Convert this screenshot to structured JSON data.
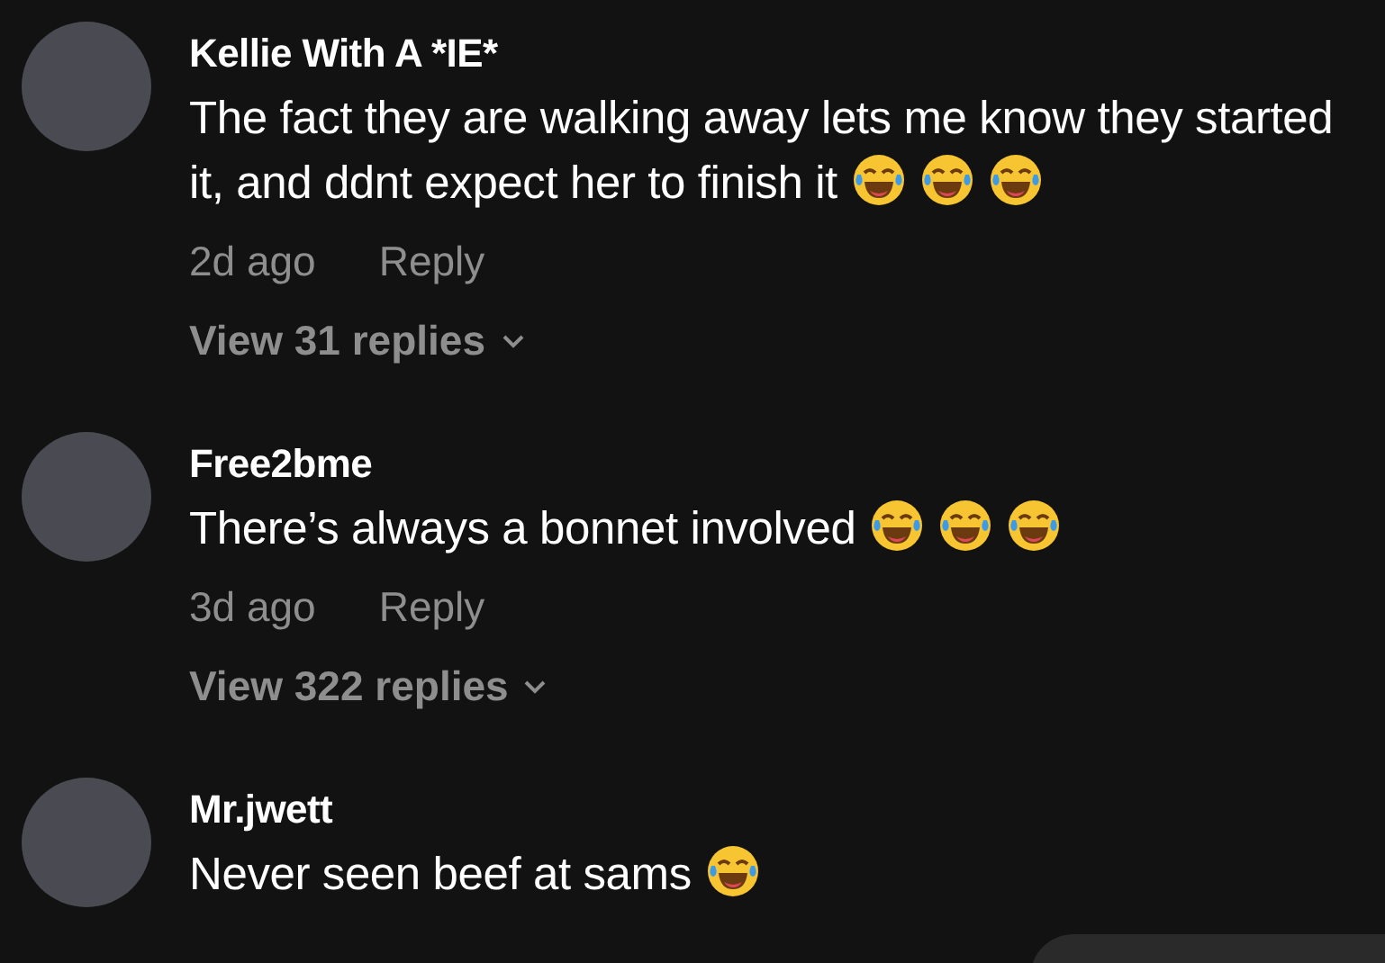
{
  "comments": [
    {
      "username": "Kellie With A *IE*",
      "text": "The fact they are walking away lets me know they started it, and ddnt expect her to finish it",
      "emoji": [
        {
          "kind": "laugh"
        },
        {
          "kind": "laugh"
        },
        {
          "kind": "laugh"
        }
      ],
      "time": "2d ago",
      "reply": "Reply",
      "view_replies": "View 31 replies"
    },
    {
      "username": "Free2bme",
      "text": "There’s always a bonnet involved",
      "emoji": [
        {
          "kind": "laugh"
        },
        {
          "kind": "laugh"
        },
        {
          "kind": "laugh"
        }
      ],
      "time": "3d ago",
      "reply": "Reply",
      "view_replies": "View 322 replies"
    },
    {
      "username": "Mr.jwett",
      "text": "Never seen beef at sams",
      "emoji": [
        {
          "kind": "laugh"
        }
      ]
    }
  ]
}
